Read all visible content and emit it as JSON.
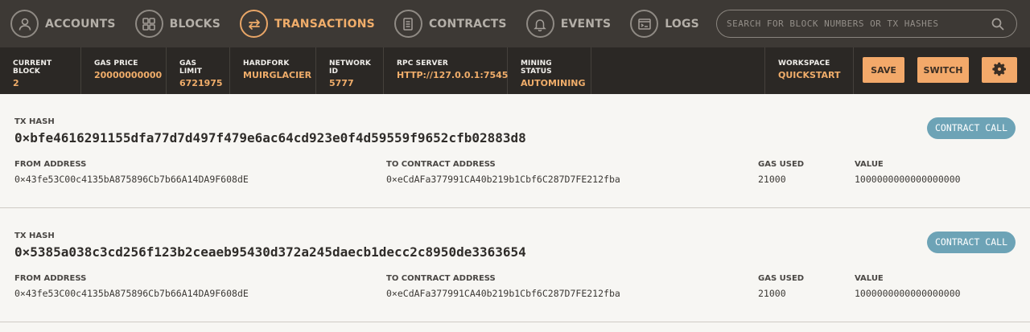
{
  "nav": {
    "items": [
      {
        "label": "ACCOUNTS",
        "icon": "account-icon"
      },
      {
        "label": "BLOCKS",
        "icon": "blocks-icon"
      },
      {
        "label": "TRANSACTIONS",
        "icon": "transactions-icon",
        "active": true
      },
      {
        "label": "CONTRACTS",
        "icon": "contracts-icon"
      },
      {
        "label": "EVENTS",
        "icon": "bell-icon"
      },
      {
        "label": "LOGS",
        "icon": "logs-icon"
      }
    ],
    "search_placeholder": "SEARCH FOR BLOCK NUMBERS OR TX HASHES"
  },
  "status": {
    "current_block": {
      "label": "CURRENT BLOCK",
      "value": "2"
    },
    "gas_price": {
      "label": "GAS PRICE",
      "value": "20000000000"
    },
    "gas_limit": {
      "label": "GAS LIMIT",
      "value": "6721975"
    },
    "hardfork": {
      "label": "HARDFORK",
      "value": "MUIRGLACIER"
    },
    "network_id": {
      "label": "NETWORK ID",
      "value": "5777"
    },
    "rpc_server": {
      "label": "RPC SERVER",
      "value": "HTTP://127.0.0.1:7545"
    },
    "mining_status": {
      "label": "MINING STATUS",
      "value": "AUTOMINING"
    },
    "workspace": {
      "label": "WORKSPACE",
      "value": "QUICKSTART"
    },
    "save_label": "SAVE",
    "switch_label": "SWITCH"
  },
  "transactions": [
    {
      "hash_label": "TX HASH",
      "hash": "0×bfe4616291155dfa77d7d497f479e6ac64cd923e0f4d59559f9652cfb02883d8",
      "badge": "CONTRACT CALL",
      "from_label": "FROM ADDRESS",
      "from": "0×43fe53C00c4135bA875896Cb7b66A14DA9F608dE",
      "to_label": "TO CONTRACT ADDRESS",
      "to": "0×eCdAFa377991CA40b219b1Cbf6C287D7FE212fba",
      "gas_label": "GAS USED",
      "gas": "21000",
      "value_label": "VALUE",
      "value": "1000000000000000000"
    },
    {
      "hash_label": "TX HASH",
      "hash": "0×5385a038c3cd256f123b2ceaeb95430d372a245daecb1decc2c8950de3363654",
      "badge": "CONTRACT CALL",
      "from_label": "FROM ADDRESS",
      "from": "0×43fe53C00c4135bA875896Cb7b66A14DA9F608dE",
      "to_label": "TO CONTRACT ADDRESS",
      "to": "0×eCdAFa377991CA40b219b1Cbf6C287D7FE212fba",
      "gas_label": "GAS USED",
      "gas": "21000",
      "value_label": "VALUE",
      "value": "1000000000000000000"
    }
  ],
  "colors": {
    "accent": "#f0ad6a",
    "nav_bg": "#3d3935",
    "status_bg": "#2b2825",
    "badge": "#6da3b6"
  }
}
